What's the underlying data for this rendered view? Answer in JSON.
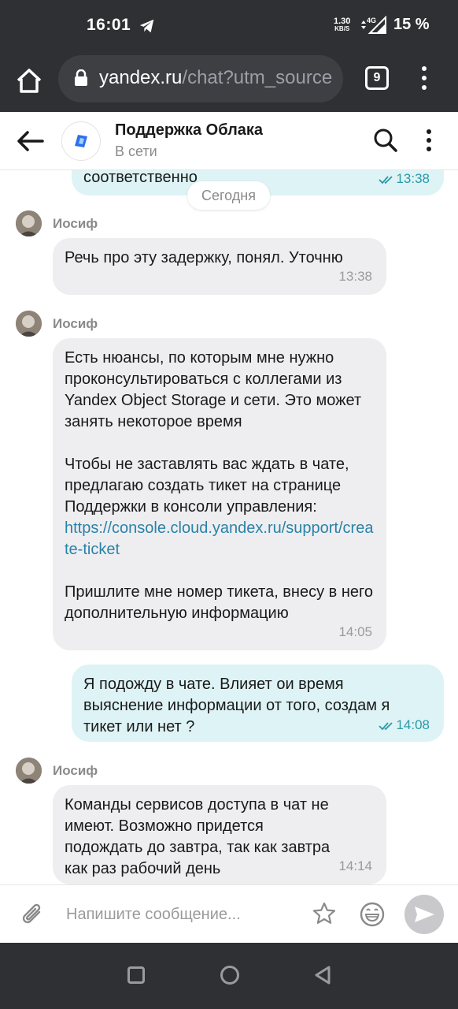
{
  "status_bar": {
    "time": "16:01",
    "speed_value": "1.30",
    "speed_unit": "KB/S",
    "network": "4G",
    "battery": "15 %"
  },
  "browser": {
    "url_domain": "yandex.ru",
    "url_rest": "/chat?utm_source",
    "tab_count": "9"
  },
  "chat_header": {
    "title": "Поддержка Облака",
    "status": "В сети"
  },
  "messages": {
    "partial_out": {
      "text": "соответственно",
      "time": "13:38"
    },
    "date_divider": "Сегодня",
    "m1": {
      "sender": "Иосиф",
      "text": "Речь про эту задержку, понял. Уточню",
      "time": "13:38"
    },
    "m2": {
      "sender": "Иосиф",
      "p1": "Есть нюансы, по которым мне нужно проконсультироваться с коллегами из Yandex Object Storage и сети. Это может занять некоторое время",
      "p2": "Чтобы не заставлять вас ждать в чате, предлагаю создать тикет на странице Поддержки в консоли управления:",
      "link": "https://console.cloud.yandex.ru/support/create-ticket",
      "p3": "Пришлите мне номер тикета, внесу в него дополнительную информацию",
      "time": "14:05"
    },
    "m3": {
      "text": "Я подожду в чате. Влияет ои время выяснение информации от того, создам я тикет или нет ?",
      "time": "14:08"
    },
    "m4": {
      "sender": "Иосиф",
      "text": "Команды сервисов доступа в чат не имеют. Возможно придется подождать до завтра, так как завтра как раз рабочий день",
      "time": "14:14"
    }
  },
  "composer": {
    "placeholder": "Напишите сообщение..."
  },
  "colors": {
    "incoming_bubble": "#eeeef0",
    "outgoing_bubble": "#def3f5",
    "link": "#2a82a8",
    "read_ticks": "#2a9aa8",
    "system_bar": "#2f3033"
  },
  "icons": {
    "home": "home-icon",
    "lock": "lock-icon",
    "back": "arrow-left-icon",
    "search": "search-icon",
    "more": "more-vertical-icon",
    "attach": "paperclip-icon",
    "star": "star-icon",
    "emoji": "emoji-icon",
    "send": "send-icon"
  }
}
